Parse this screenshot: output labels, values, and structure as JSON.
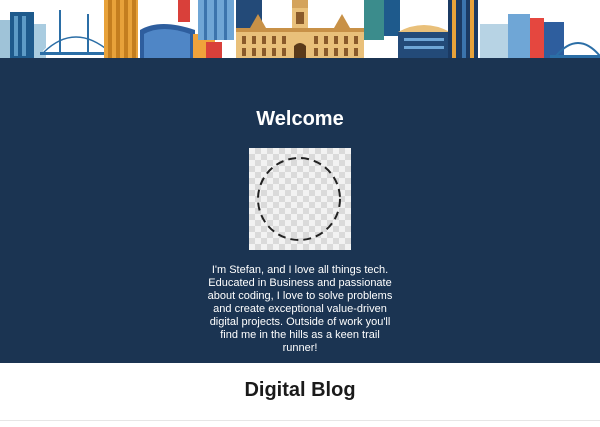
{
  "header": {
    "banner_icon": "city-skyline-illustration"
  },
  "welcome": {
    "title": "Welcome",
    "avatar_icon": "profile-placeholder-circle",
    "bio": "I'm Stefan, and I love all things tech. Educated in Business and passionate about coding, I love to solve problems and create exceptional value-driven digital projects. Outside of work you'll find me in the hills as a keen trail runner!"
  },
  "blog": {
    "title": "Digital Blog"
  },
  "colors": {
    "section_background": "#1b3452",
    "text_light": "#ffffff",
    "text_dark": "#1a1a1a"
  }
}
